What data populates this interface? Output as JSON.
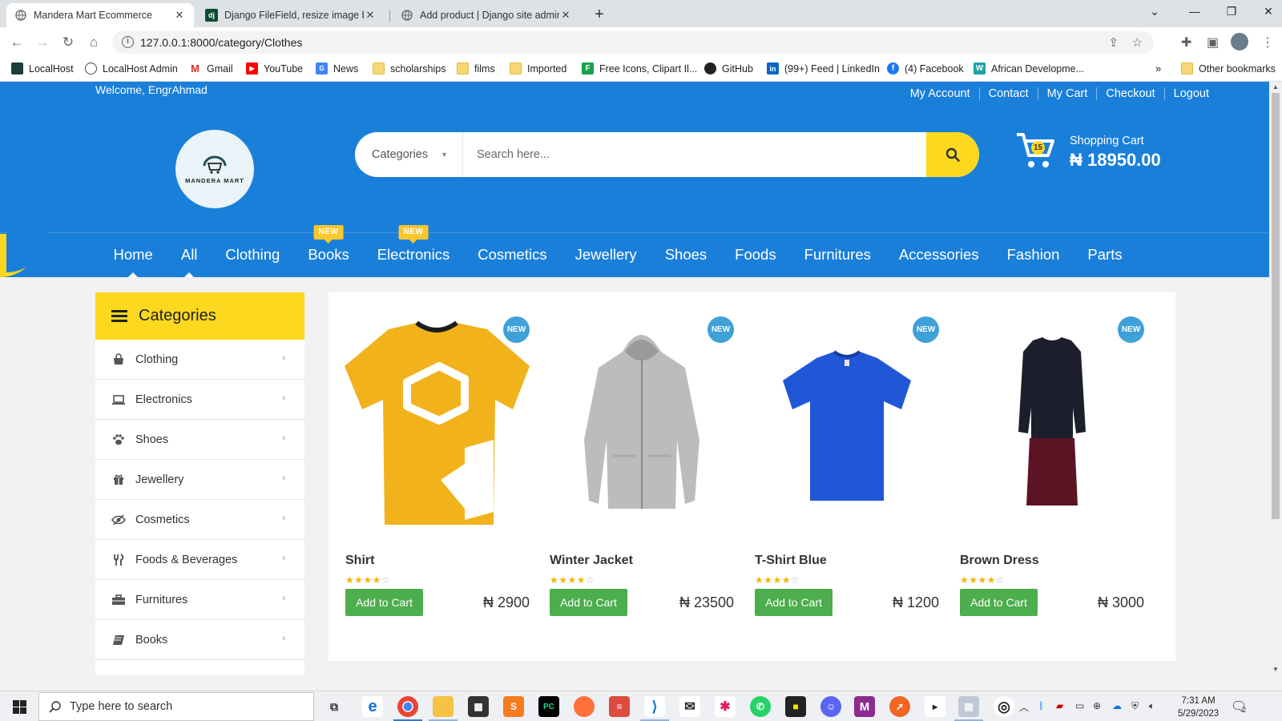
{
  "browser": {
    "tabs": [
      {
        "title": "Mandera Mart Ecommerce",
        "icon": "globe-icon",
        "active": true
      },
      {
        "title": "Django FileField, resize image be",
        "icon": "django-icon",
        "active": false
      },
      {
        "title": "Add product | Django site admin",
        "icon": "globe-icon",
        "active": false
      }
    ],
    "url": "127.0.0.1:8000/category/Clothes",
    "bookmarks": [
      {
        "label": "LocalHost",
        "icon": "localhost-icon",
        "color": "#1d3d3a"
      },
      {
        "label": "LocalHost Admin",
        "icon": "globe-icon",
        "color": "#555555"
      },
      {
        "label": "Gmail",
        "icon": "gmail-icon",
        "color": "#d93025"
      },
      {
        "label": "YouTube",
        "icon": "youtube-icon",
        "color": "#ff0000"
      },
      {
        "label": "News",
        "icon": "news-icon",
        "color": "#4285f4"
      },
      {
        "label": "scholarships",
        "icon": "folder-icon",
        "color": "#f7d774"
      },
      {
        "label": "films",
        "icon": "folder-icon",
        "color": "#f7d774"
      },
      {
        "label": "Imported",
        "icon": "folder-icon",
        "color": "#f7d774"
      },
      {
        "label": "Free Icons, Clipart Il...",
        "icon": "flaticon-icon",
        "color": "#16a34a"
      },
      {
        "label": "GitHub",
        "icon": "github-icon",
        "color": "#222222"
      },
      {
        "label": "(99+) Feed | LinkedIn",
        "icon": "linkedin-icon",
        "color": "#0a66c2"
      },
      {
        "label": "(4) Facebook",
        "icon": "facebook-icon",
        "color": "#1877f2"
      },
      {
        "label": "African Developme...",
        "icon": "afdb-icon",
        "color": "#1aa3a3"
      }
    ],
    "overflow": "»",
    "other_bookmarks": "Other bookmarks"
  },
  "site": {
    "welcome": "Welcome, EngrAhmad",
    "top_links": [
      "My Account",
      "Contact",
      "My Cart",
      "Checkout",
      "Logout"
    ],
    "logo_text": "MANDERA MART",
    "search": {
      "category_label": "Categories",
      "placeholder": "Search here..."
    },
    "cart": {
      "count": "15",
      "label": "Shopping Cart",
      "total": "₦ 18950.00"
    },
    "nav": [
      {
        "label": "Home",
        "pointer": true,
        "badge": ""
      },
      {
        "label": "All",
        "pointer": true,
        "badge": ""
      },
      {
        "label": "Clothing",
        "pointer": false,
        "badge": ""
      },
      {
        "label": "Books",
        "pointer": false,
        "badge": "NEW"
      },
      {
        "label": "Electronics",
        "pointer": false,
        "badge": "NEW"
      },
      {
        "label": "Cosmetics",
        "pointer": false,
        "badge": ""
      },
      {
        "label": "Jewellery",
        "pointer": false,
        "badge": ""
      },
      {
        "label": "Shoes",
        "pointer": false,
        "badge": ""
      },
      {
        "label": "Foods",
        "pointer": false,
        "badge": ""
      },
      {
        "label": "Furnitures",
        "pointer": false,
        "badge": ""
      },
      {
        "label": "Accessories",
        "pointer": false,
        "badge": ""
      },
      {
        "label": "Fashion",
        "pointer": false,
        "badge": ""
      },
      {
        "label": "Parts",
        "pointer": false,
        "badge": ""
      }
    ],
    "sidebar": {
      "title": "Categories",
      "items": [
        {
          "label": "Clothing",
          "icon": "shopping-bag-icon"
        },
        {
          "label": "Electronics",
          "icon": "laptop-icon"
        },
        {
          "label": "Shoes",
          "icon": "paw-icon"
        },
        {
          "label": "Jewellery",
          "icon": "gift-icon"
        },
        {
          "label": "Cosmetics",
          "icon": "eye-slash-icon"
        },
        {
          "label": "Foods & Beverages",
          "icon": "cutlery-icon"
        },
        {
          "label": "Furnitures",
          "icon": "briefcase-icon"
        },
        {
          "label": "Books",
          "icon": "book-icon"
        }
      ]
    },
    "products": [
      {
        "name": "Shirt",
        "price": "₦ 2900",
        "rating": 4,
        "badge": "NEW",
        "button": "Add to Cart",
        "image": "yellow-tshirt"
      },
      {
        "name": "Winter Jacket",
        "price": "₦ 23500",
        "rating": 4,
        "badge": "NEW",
        "button": "Add to Cart",
        "image": "grey-hoodie"
      },
      {
        "name": "T-Shirt Blue",
        "price": "₦ 1200",
        "rating": 4,
        "badge": "NEW",
        "button": "Add to Cart",
        "image": "blue-tshirt"
      },
      {
        "name": "Brown Dress",
        "price": "₦ 3000",
        "rating": 4,
        "badge": "NEW",
        "button": "Add to Cart",
        "image": "dark-dress"
      }
    ],
    "colors": {
      "primary": "#1a7fd9",
      "accent": "#fcd81f",
      "button": "#4cae4c",
      "badge": "#3ea1d8"
    }
  },
  "taskbar": {
    "search_placeholder": "Type here to search",
    "time": "7:31 AM",
    "date": "5/29/2023",
    "notifications": "2"
  }
}
